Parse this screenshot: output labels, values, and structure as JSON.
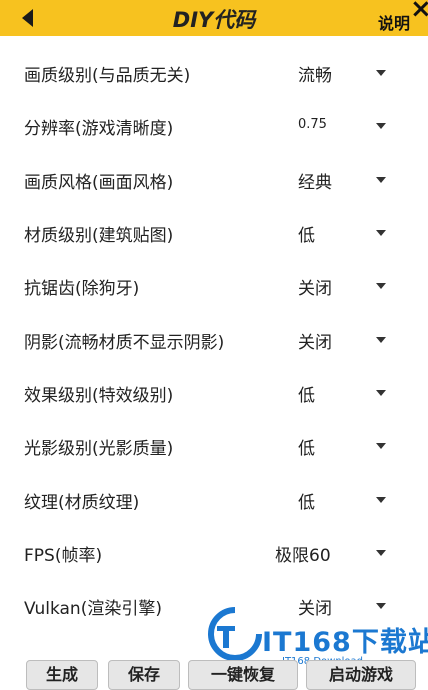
{
  "header": {
    "title": "DIY代码",
    "help_label": "说明",
    "close_glyph": "×"
  },
  "settings": [
    {
      "label": "画质级别(与品质无关)",
      "value": "流畅"
    },
    {
      "label": "分辨率(游戏清晰度)",
      "value": "0.75"
    },
    {
      "label": "画质风格(画面风格)",
      "value": "经典"
    },
    {
      "label": "材质级别(建筑贴图)",
      "value": "低"
    },
    {
      "label": "抗锯齿(除狗牙)",
      "value": "关闭"
    },
    {
      "label": "阴影(流畅材质不显示阴影)",
      "value": "关闭"
    },
    {
      "label": "效果级别(特效级别)",
      "value": "低"
    },
    {
      "label": "光影级别(光影质量)",
      "value": "低"
    },
    {
      "label": "纹理(材质纹理)",
      "value": "低"
    },
    {
      "label": "FPS(帧率)",
      "value": "极限60"
    },
    {
      "label": "Vulkan(渲染引擎)",
      "value": "关闭"
    }
  ],
  "buttons": {
    "generate": "生成",
    "save": "保存",
    "restore": "一键恢复",
    "launch": "启动游戏"
  },
  "watermark": {
    "brand": "IT168下载站",
    "sub": "IT168 Download"
  },
  "colors": {
    "header_bg": "#f7c21f",
    "watermark": "#1b78d1"
  }
}
